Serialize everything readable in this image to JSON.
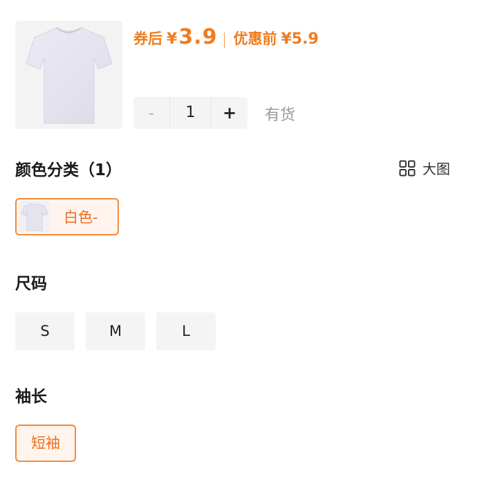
{
  "price": {
    "coupon_label": "券后",
    "currency": "¥",
    "coupon_price": "3.9",
    "original_label": "优惠前",
    "original_price": "¥5.9"
  },
  "quantity": {
    "minus": "-",
    "value": "1",
    "plus": "+"
  },
  "stock_status": "有货",
  "color_section": {
    "title": "颜色分类（1）",
    "big_image_label": "大图",
    "options": [
      {
        "label": "白色-",
        "selected": true
      }
    ]
  },
  "size_section": {
    "title": "尺码",
    "options": [
      "S",
      "M",
      "L"
    ]
  },
  "sleeve_section": {
    "title": "袖长",
    "options": [
      {
        "label": "短袖",
        "selected": true
      }
    ]
  },
  "colors": {
    "accent": "#f07c1e",
    "chip_bg": "#fff5ee",
    "option_bg": "#f4f4f5"
  }
}
